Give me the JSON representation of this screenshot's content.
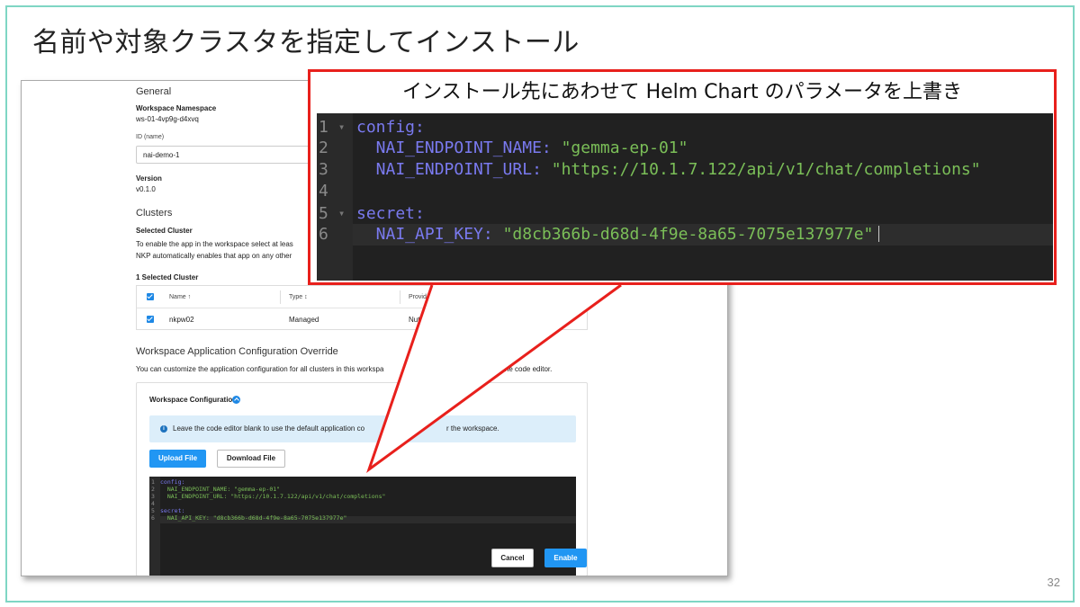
{
  "slide": {
    "title": "名前や対象クラスタを指定してインストール",
    "page_number": "32"
  },
  "screenshot": {
    "general": {
      "heading": "General",
      "workspace_namespace_label": "Workspace Namespace",
      "workspace_namespace_value": "ws-01-4vp9g-d4xvq",
      "id_label": "ID (name)",
      "id_value": "nai-demo-1",
      "version_label": "Version",
      "version_value": "v0.1.0"
    },
    "clusters": {
      "heading": "Clusters",
      "selected_cluster_label": "Selected Cluster",
      "description_line1": "To enable the app in the workspace select at leas",
      "description_line2": "NKP automatically enables that app on any other",
      "selected_count": "1 Selected Cluster",
      "table": {
        "headers": [
          "Name ↑",
          "Type ↕",
          "Provid"
        ],
        "rows": [
          {
            "name": "nkpw02",
            "type": "Managed",
            "provider": "Nut"
          }
        ]
      }
    },
    "override": {
      "heading": "Workspace Application Configuration Override",
      "description_left": "You can customize the application configuration for all clusters in this workspa",
      "description_right": "n the code editor.",
      "card_title": "Workspace Configuration",
      "info_icon": "info-circle-icon",
      "info_text_left": "Leave the code editor blank to use the default application co",
      "info_text_right": "r the workspace.",
      "upload_label": "Upload File",
      "download_label": "Download File"
    },
    "editor_lines": [
      {
        "num": "1",
        "fold": "▾",
        "text": "config:"
      },
      {
        "num": "2",
        "fold": "",
        "text": "  NAI_ENDPOINT_NAME: \"gemma-ep-01\""
      },
      {
        "num": "3",
        "fold": "",
        "text": "  NAI_ENDPOINT_URL: \"https://10.1.7.122/api/v1/chat/completions\""
      },
      {
        "num": "4",
        "fold": "",
        "text": ""
      },
      {
        "num": "5",
        "fold": "▾",
        "text": "secret:"
      },
      {
        "num": "6",
        "fold": "",
        "text": "  NAI_API_KEY: \"d8cb366b-d68d-4f9e-8a65-7075e137977e\""
      }
    ],
    "cancel_label": "Cancel",
    "enable_label": "Enable"
  },
  "callout": {
    "title": "インストール先にあわせて Helm Chart のパラメータを上書き",
    "lines": [
      {
        "num": "1",
        "fold": "▾",
        "key": "config:",
        "value": ""
      },
      {
        "num": "2",
        "fold": "",
        "key": "  NAI_ENDPOINT_NAME: ",
        "value": "\"gemma-ep-01\""
      },
      {
        "num": "3",
        "fold": "",
        "key": "  NAI_ENDPOINT_URL: ",
        "value": "\"https://10.1.7.122/api/v1/chat/completions\""
      },
      {
        "num": "4",
        "fold": "",
        "key": "",
        "value": ""
      },
      {
        "num": "5",
        "fold": "▾",
        "key": "secret:",
        "value": ""
      },
      {
        "num": "6",
        "fold": "",
        "key": "  NAI_API_KEY: ",
        "value": "\"d8cb366b-d68d-4f9e-8a65-7075e137977e\""
      }
    ]
  },
  "colors": {
    "frame": "#7fd6c4",
    "callout_border": "#e8201c",
    "primary_button": "#2196f3",
    "editor_bg": "#212121",
    "yaml_key": "#7a7af0",
    "yaml_string": "#7bbf58"
  }
}
